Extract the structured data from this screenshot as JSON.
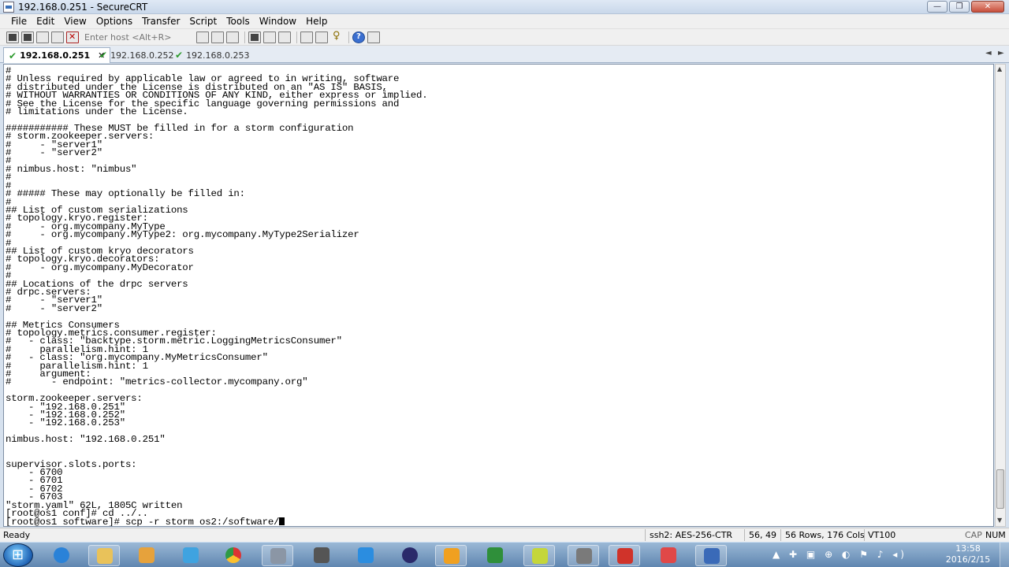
{
  "window": {
    "title": "192.168.0.251 - SecureCRT",
    "min_label": "—",
    "restore_label": "❐",
    "close_label": "✕"
  },
  "menu": [
    "File",
    "Edit",
    "View",
    "Options",
    "Transfer",
    "Script",
    "Tools",
    "Window",
    "Help"
  ],
  "toolbar": {
    "host_placeholder": "Enter host <Alt+R>"
  },
  "tabs": [
    {
      "label": "192.168.0.251",
      "active": true,
      "close": "✕"
    },
    {
      "label": "192.168.0.252",
      "active": false
    },
    {
      "label": "192.168.0.253",
      "active": false
    }
  ],
  "tab_nav": {
    "prev": "◄",
    "next": "►"
  },
  "terminal": {
    "lines": [
      "#",
      "# Unless required by applicable law or agreed to in writing, software",
      "# distributed under the License is distributed on an \"AS IS\" BASIS,",
      "# WITHOUT WARRANTIES OR CONDITIONS OF ANY KIND, either express or implied.",
      "# See the License for the specific language governing permissions and",
      "# limitations under the License.",
      "",
      "########### These MUST be filled in for a storm configuration",
      "# storm.zookeeper.servers:",
      "#     - \"server1\"",
      "#     - \"server2\"",
      "#",
      "# nimbus.host: \"nimbus\"",
      "#",
      "#",
      "# ##### These may optionally be filled in:",
      "#",
      "## List of custom serializations",
      "# topology.kryo.register:",
      "#     - org.mycompany.MyType",
      "#     - org.mycompany.MyType2: org.mycompany.MyType2Serializer",
      "#",
      "## List of custom kryo decorators",
      "# topology.kryo.decorators:",
      "#     - org.mycompany.MyDecorator",
      "#",
      "## Locations of the drpc servers",
      "# drpc.servers:",
      "#     - \"server1\"",
      "#     - \"server2\"",
      "",
      "## Metrics Consumers",
      "# topology.metrics.consumer.register:",
      "#   - class: \"backtype.storm.metric.LoggingMetricsConsumer\"",
      "#     parallelism.hint: 1",
      "#   - class: \"org.mycompany.MyMetricsConsumer\"",
      "#     parallelism.hint: 1",
      "#     argument:",
      "#       - endpoint: \"metrics-collector.mycompany.org\"",
      "",
      "storm.zookeeper.servers:",
      "    - \"192.168.0.251\"",
      "    - \"192.168.0.252\"",
      "    - \"192.168.0.253\"",
      "",
      "nimbus.host: \"192.168.0.251\"",
      "",
      "",
      "supervisor.slots.ports:",
      "    - 6700",
      "    - 6701",
      "    - 6702",
      "    - 6703",
      "\"storm.yaml\" 62L, 1805C written",
      "[root@os1 conf]# cd ../..",
      "[root@os1 software]# scp -r storm os2:/software/"
    ]
  },
  "status": {
    "ready": "Ready",
    "cipher": "ssh2: AES-256-CTR",
    "position": "56,  49",
    "size": "56 Rows, 176 Cols",
    "emulation": "VT100",
    "caps": "CAP",
    "num": "NUM"
  },
  "taskbar": {
    "tray_icons": "▲ ✚ ▣ ⊕ ◐ ⚑ ♪ ◂)",
    "time": "13:58",
    "date": "2016/2/15"
  },
  "colors": {
    "accent": "#3a70b8",
    "check": "#2e9a2e"
  }
}
